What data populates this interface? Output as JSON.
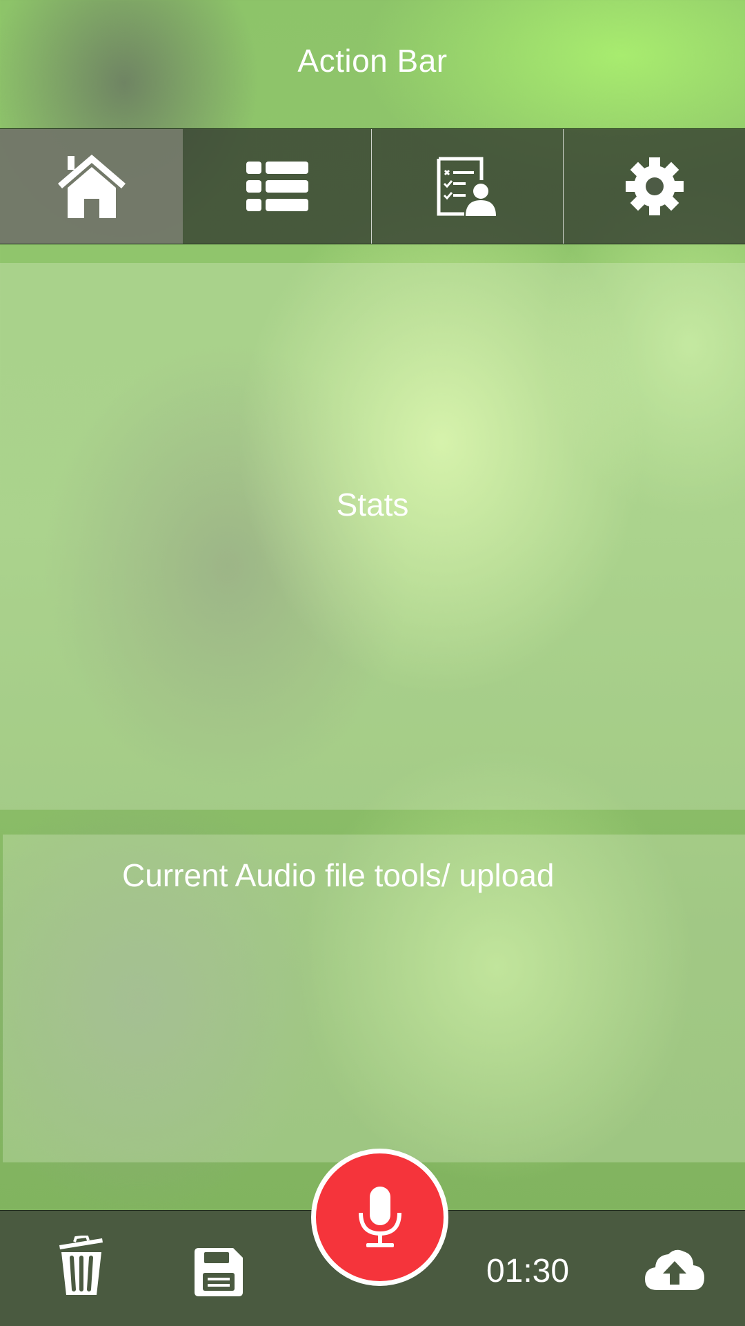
{
  "action_bar": {
    "title": "Action Bar"
  },
  "tabs": [
    {
      "name": "home",
      "icon": "home-icon",
      "active": true
    },
    {
      "name": "list",
      "icon": "list-icon",
      "active": false
    },
    {
      "name": "report",
      "icon": "checklist-user-icon",
      "active": false
    },
    {
      "name": "settings",
      "icon": "gear-icon",
      "active": false
    }
  ],
  "stats": {
    "label": "Stats"
  },
  "audio_tools": {
    "label": "Current Audio file tools/ upload"
  },
  "bottom_bar": {
    "delete_icon": "trash-icon",
    "save_icon": "floppy-disk-icon",
    "record_icon": "microphone-icon",
    "timer": "01:30",
    "upload_icon": "cloud-upload-icon"
  },
  "colors": {
    "record": "#f5343b",
    "bar": "#4a5a40",
    "text": "#ffffff"
  }
}
